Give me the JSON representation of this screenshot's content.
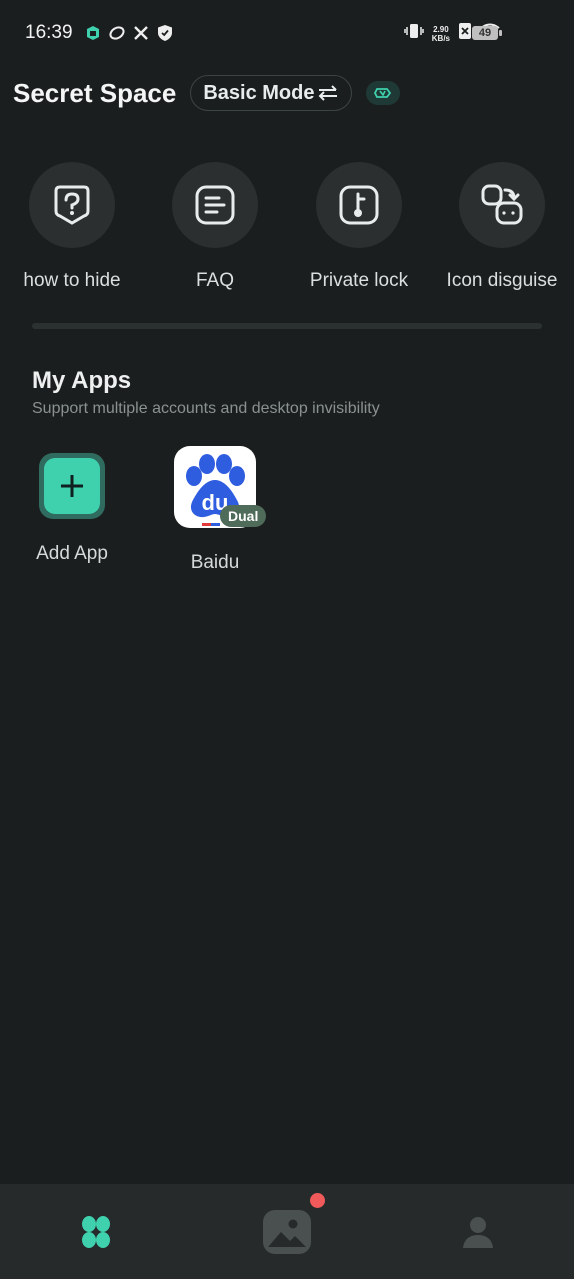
{
  "status_bar": {
    "time": "16:39",
    "net_speed_value": "2.90",
    "net_speed_unit": "KB/s",
    "battery": "49",
    "icons": [
      "app-notification-icon",
      "sync-icon",
      "tools-icon",
      "shield-icon",
      "vibrate-icon",
      "sim-x-icon",
      "wifi-icon",
      "battery-icon"
    ]
  },
  "header": {
    "title": "Secret Space",
    "mode_label": "Basic Mode",
    "mode_icon": "swap-arrows-icon",
    "badge_icon": "vip-badge-icon"
  },
  "features": [
    {
      "label": "how to hide",
      "icon": "question-shield-icon"
    },
    {
      "label": "FAQ",
      "icon": "faq-list-icon"
    },
    {
      "label": "Private lock",
      "icon": "lock-key-icon"
    },
    {
      "label": "Icon disguise",
      "icon": "icon-swap-icon"
    }
  ],
  "my_apps": {
    "title": "My Apps",
    "subtitle": "Support multiple accounts and desktop invisibility",
    "items": [
      {
        "label": "Add App",
        "icon": "plus-icon"
      },
      {
        "label": "Baidu",
        "icon": "baidu-paw-icon",
        "badge": "Dual"
      }
    ]
  },
  "bottom_nav": {
    "items": [
      "home-grid-icon",
      "gallery-icon",
      "profile-icon"
    ],
    "active": "home-grid-icon",
    "colors": {
      "accent": "#3fd1ad",
      "notification_dot": "#f05a5a"
    }
  }
}
